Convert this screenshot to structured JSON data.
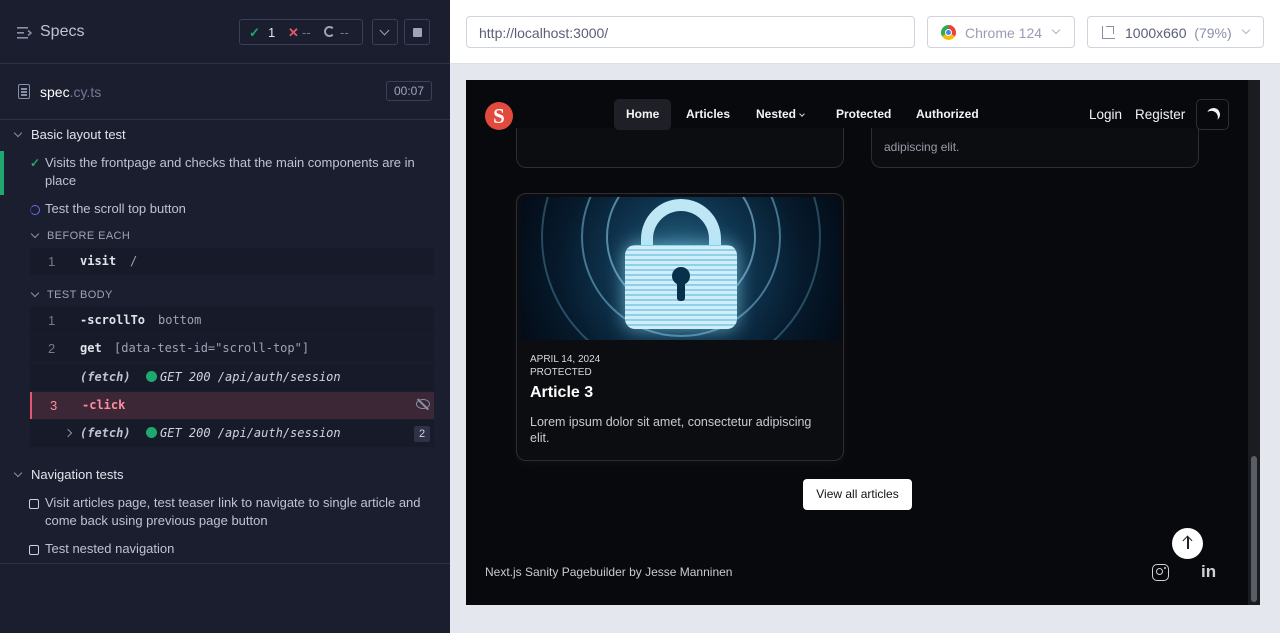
{
  "runner": {
    "title": "Specs",
    "stats": {
      "passed": "1",
      "failed": "--",
      "pending": "--"
    },
    "spec_file": {
      "name": "spec",
      "ext": ".cy.ts",
      "duration": "00:07"
    },
    "suites": [
      {
        "title": "Basic layout test",
        "tests": [
          {
            "title": "Visits the frontpage and checks that the main components are in place",
            "state": "passed"
          },
          {
            "title": "Test the scroll top button",
            "state": "running"
          }
        ]
      },
      {
        "title": "Navigation tests",
        "tests": [
          {
            "title": "Visit articles page, test teaser link to navigate to single article and come back using previous page button",
            "state": "pending"
          },
          {
            "title": "Test nested navigation",
            "state": "pending"
          }
        ]
      }
    ],
    "before_each": {
      "label": "BEFORE EACH",
      "commands": [
        {
          "num": "1",
          "name": "visit",
          "arg": "/"
        }
      ]
    },
    "test_body": {
      "label": "TEST BODY",
      "commands": [
        {
          "num": "1",
          "name": "-scrollTo",
          "arg": "bottom"
        },
        {
          "num": "2",
          "name": "get",
          "arg": "[data-test-id=\"scroll-top\"]"
        },
        {
          "num": "",
          "name": "(fetch)",
          "arg": "GET 200 /api/auth/session"
        },
        {
          "num": "3",
          "name": "-click",
          "arg": ""
        },
        {
          "num": "",
          "name": "(fetch)",
          "arg": "GET 200 /api/auth/session",
          "count": "2"
        }
      ]
    }
  },
  "browser": {
    "url": "http://localhost:3000/",
    "name": "Chrome 124",
    "viewport": "1000x660",
    "zoom": "(79%)"
  },
  "site": {
    "logo_letter": "S",
    "nav": [
      "Home",
      "Articles",
      "Nested",
      "Protected",
      "Authorized"
    ],
    "login": "Login",
    "register": "Register",
    "stub_text": "adipiscing elit.",
    "article": {
      "date": "APRIL 14, 2024",
      "tag": "PROTECTED",
      "title": "Article 3",
      "desc": "Lorem ipsum dolor sit amet, consectetur adipiscing elit."
    },
    "view_all": "View all articles",
    "footer": "Next.js Sanity Pagebuilder by Jesse Manninen",
    "social": {
      "linkedin": "in"
    }
  },
  "colors": {
    "runner_bg": "#1b1e2e",
    "pass": "#1fa971",
    "fail": "#e45770",
    "site_bg": "#08090c",
    "logo": "#e14a3c"
  }
}
